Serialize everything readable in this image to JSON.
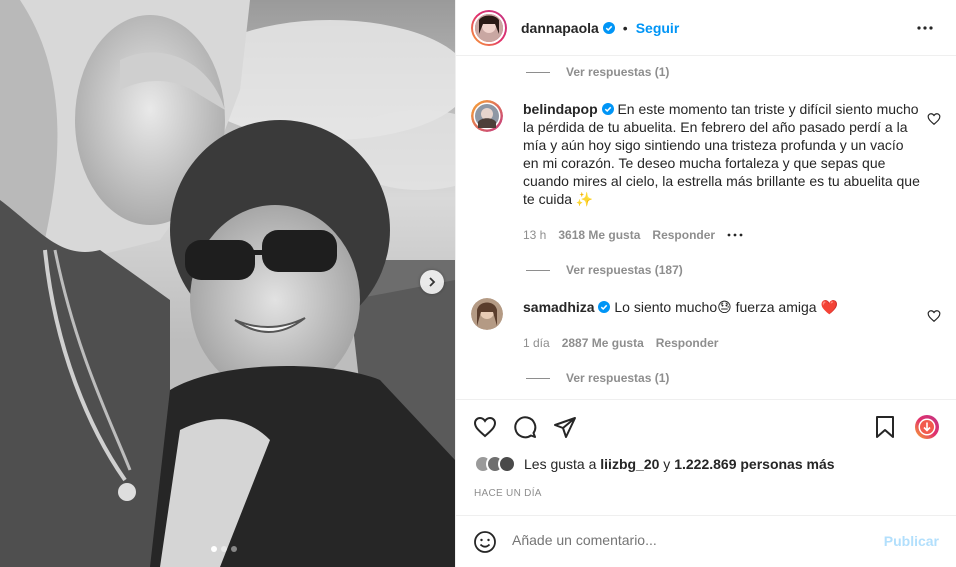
{
  "post": {
    "author": "dannapaola",
    "follow_label": "Seguir",
    "carousel": {
      "slides": 3,
      "active": 1
    }
  },
  "comments": {
    "top_replies": "Ver respuestas (1)",
    "items": [
      {
        "user": "belindapop",
        "text": " En este momento tan triste y difícil siento mucho la pérdida de tu abuelita. En febrero del año pasado perdí a la mía y aún hoy sigo sintiendo una tristeza profunda y un vacío en mi corazón. Te deseo mucha fortaleza y que sepas que cuando mires al cielo, la estrella más brillante es tu abuelita que te cuida ✨",
        "time": "13 h",
        "likes": "3618 Me gusta",
        "reply_label": "Responder",
        "replies": "Ver respuestas (187)"
      },
      {
        "user": "samadhiza",
        "text_before": " Lo siento mucho",
        "emoji": "😓",
        "text_after": " fuerza amiga ",
        "heart": "❤️",
        "time": "1 día",
        "likes": "2887 Me gusta",
        "reply_label": "Responder",
        "replies": "Ver respuestas (1)"
      }
    ]
  },
  "actions": {
    "likes_prefix": "Les gusta a ",
    "likes_user": "liizbg_20",
    "likes_join": " y ",
    "likes_count": "1.222.869 personas más",
    "time_ago": "HACE UN DÍA"
  },
  "composer": {
    "placeholder": "Añade un comentario...",
    "publish_label": "Publicar"
  },
  "colors": {
    "accent": "#0095f6",
    "verified": "#0095f6",
    "publish_disabled": "#b2dffc"
  }
}
